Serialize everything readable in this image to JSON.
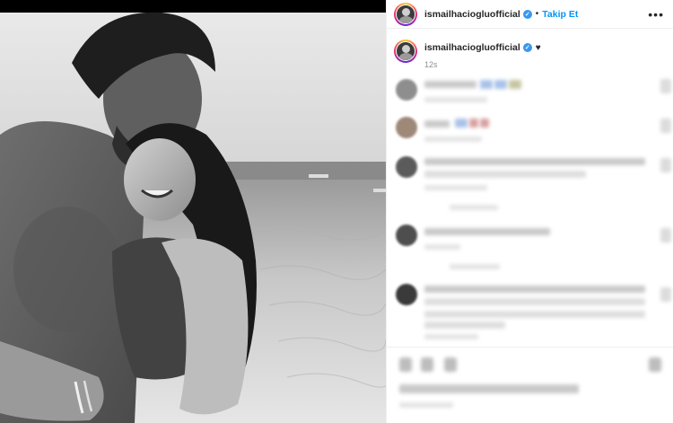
{
  "post": {
    "username": "ismailhacioglu​official",
    "verified_mark": "✓",
    "follow_label": "Takip Et",
    "separator": "•",
    "more_icon": "•••",
    "caption_heart": "♥",
    "timestamp": "12s"
  },
  "photo": {
    "description_icon": "photo-bw"
  },
  "colors": {
    "accent": "#0095f6",
    "verified": "#3897f0"
  }
}
